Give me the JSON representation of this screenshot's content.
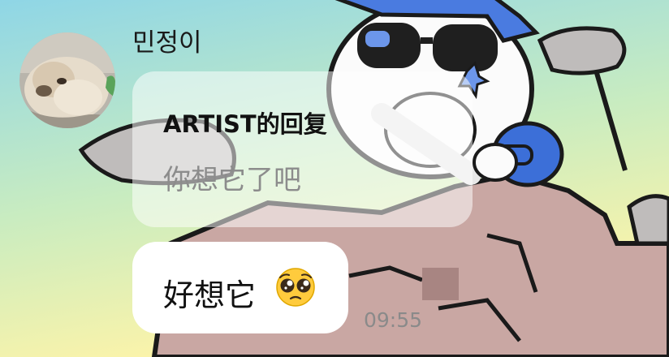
{
  "conversation": {
    "sender_name": "민정이",
    "messages": [
      {
        "type": "artist_reply",
        "title": "ARTIST的回复",
        "quoted_text": "你想它了吧"
      },
      {
        "type": "text",
        "text": "好想它",
        "emoji": "pleading-face-emoji"
      }
    ],
    "timestamp": "09:55"
  },
  "colors": {
    "sky_top": "#8fd6e6",
    "sky_bottom": "#fff4a8",
    "rock": "#c9a7a3",
    "character_accent": "#3c6fd8",
    "bubble_white": "#ffffff",
    "quoted_text": "#8c8c8c",
    "timestamp_text": "#8a8a8a"
  }
}
